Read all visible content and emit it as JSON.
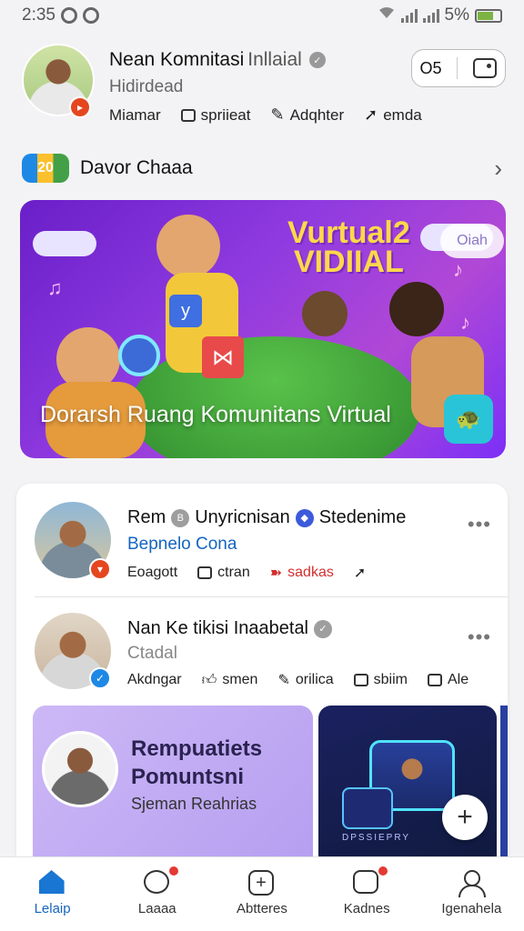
{
  "status_bar": {
    "time": "2:35",
    "battery": "5%"
  },
  "profile": {
    "name": "Nean Komnitasi",
    "name_light": "Inllaial",
    "subtitle": "Hidirdead",
    "actions": [
      {
        "label": "Miamar"
      },
      {
        "label": "spriieat"
      },
      {
        "label": "Adqhter"
      },
      {
        "label": "emda"
      }
    ],
    "pill_count": "O5"
  },
  "section": {
    "logo": "20",
    "title": "Davor Chaaa"
  },
  "banner": {
    "tag_line1": "Vurtual2",
    "tag_line2": "VIDIIAL",
    "badge": "Oiah",
    "title": "Dorarsh Ruang Komunitans Virtual"
  },
  "posts": [
    {
      "name": "Rem",
      "name2": "Unyricnisan",
      "name3": "Stedenime",
      "meta": "Bepnelo Cona",
      "meta_color": "#1565c0",
      "actions": [
        "Eoagott",
        "ctran",
        "sadkas"
      ]
    },
    {
      "name": "Nan Ke tikisi Inaabetal",
      "meta": "Ctadal",
      "meta_color": "#888888",
      "actions": [
        "Akdngar",
        "smen",
        "orilica",
        "sbiim",
        "Ale"
      ]
    }
  ],
  "tiles": {
    "purple_line1": "Rempuatiets",
    "purple_line2": "Pomuntsni",
    "purple_line3": "Sjeman Reahrias",
    "dark_caption": "DPSSIEPRY"
  },
  "bottom_nav": [
    {
      "label": "Lelaip"
    },
    {
      "label": "Laaaa"
    },
    {
      "label": "Abtteres"
    },
    {
      "label": "Kadnes"
    },
    {
      "label": "Igenahela"
    }
  ]
}
